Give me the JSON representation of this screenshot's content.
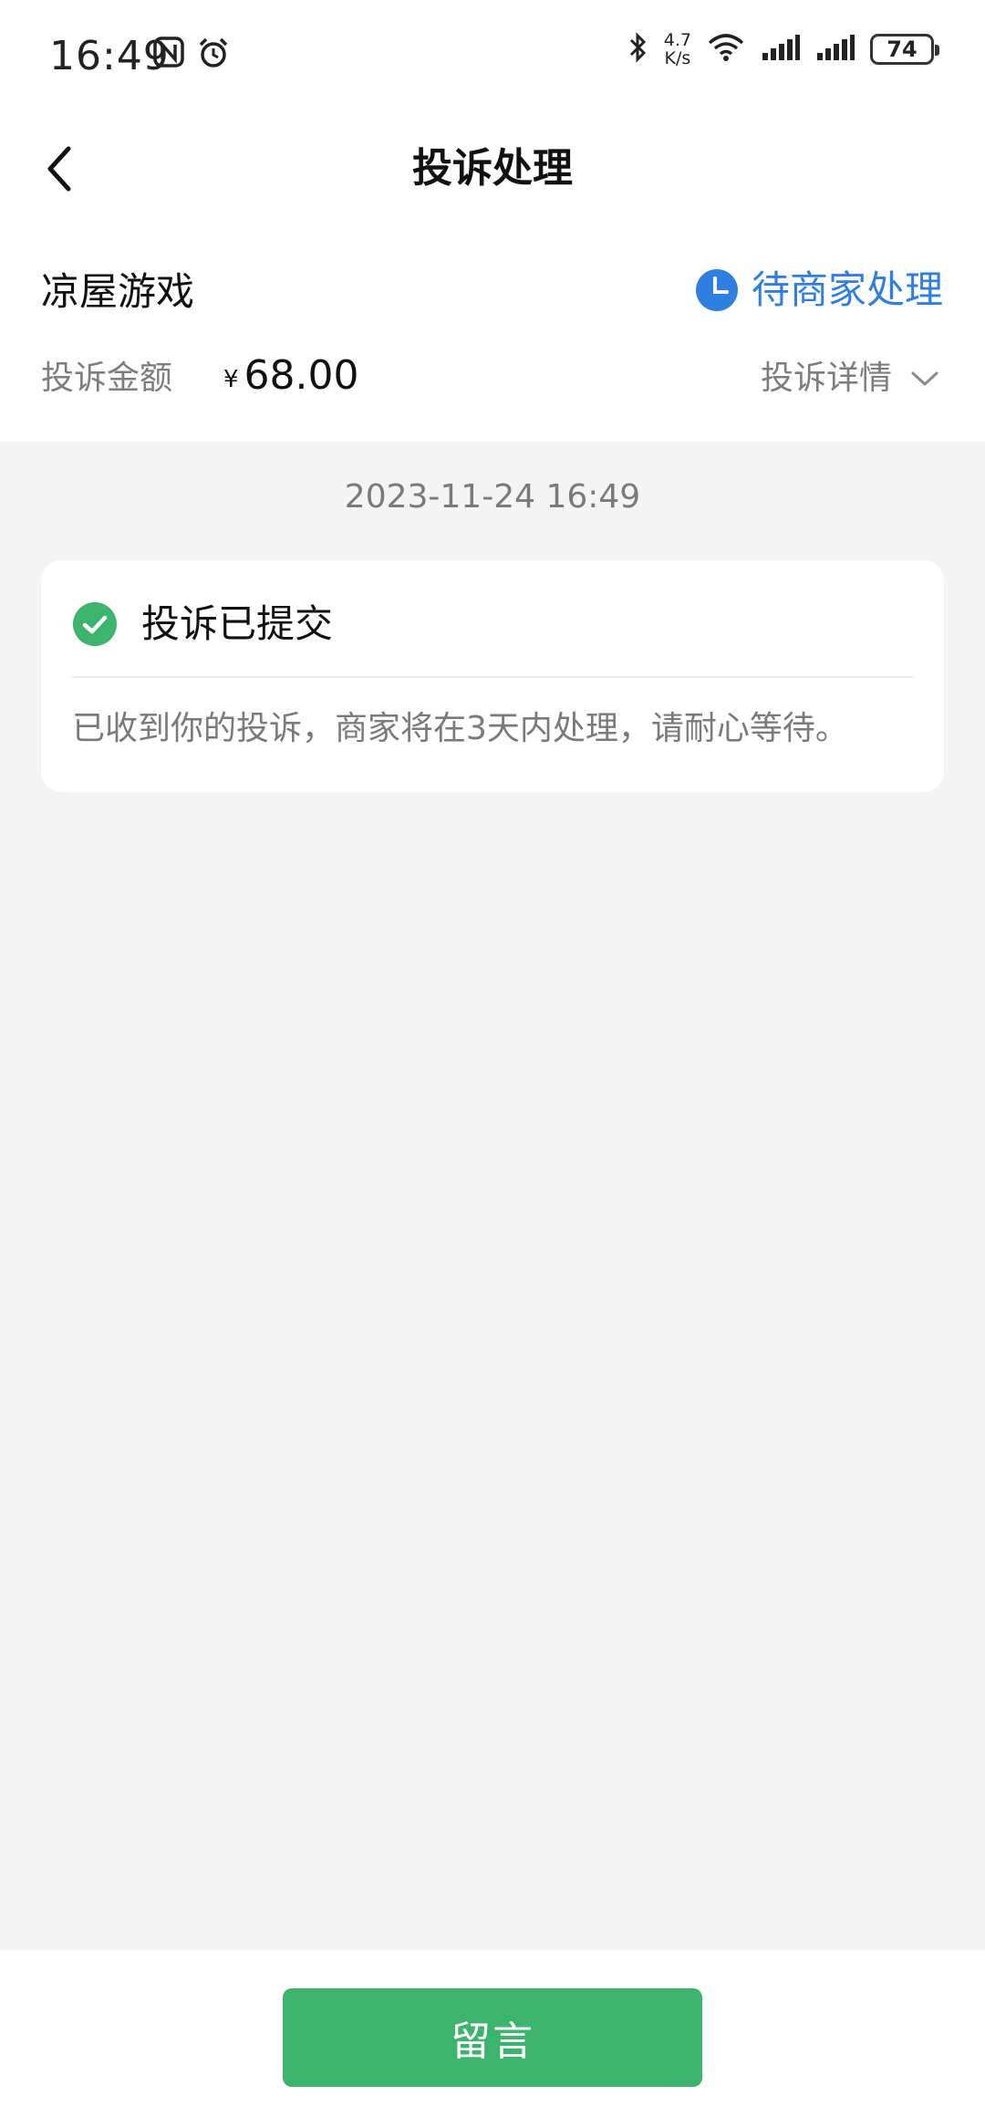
{
  "status_bar": {
    "time": "16:49",
    "network_speed_value": "4.7",
    "network_speed_unit": "K/s",
    "battery": "74"
  },
  "nav": {
    "title": "投诉处理"
  },
  "header": {
    "merchant_name": "凉屋游戏",
    "status_label": "待商家处理",
    "amount_label": "投诉金额",
    "currency_symbol": "¥",
    "amount_value": "68.00",
    "details_label": "投诉详情"
  },
  "timeline": {
    "timestamp": "2023-11-24 16:49",
    "card_title": "投诉已提交",
    "card_text": "已收到你的投诉，商家将在3天内处理，请耐心等待。"
  },
  "actions": {
    "leave_message_label": "留言"
  },
  "colors": {
    "accent_blue": "#2f7fe0",
    "success_green": "#3cb46e",
    "background": "#f4f4f4"
  }
}
